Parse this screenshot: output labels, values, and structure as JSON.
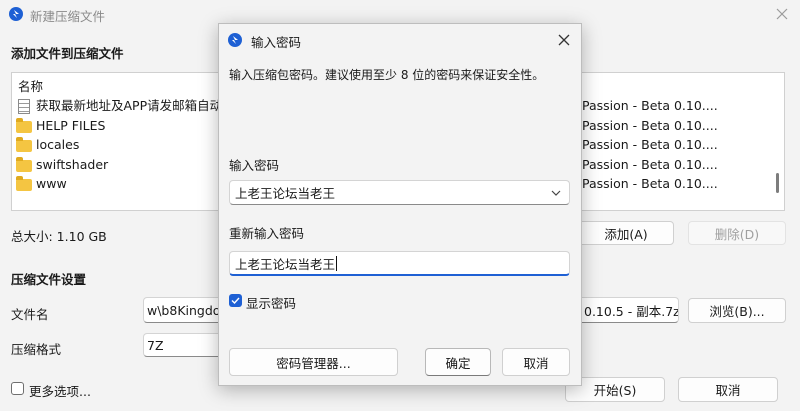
{
  "main": {
    "title": "新建压缩文件",
    "add_section_title": "添加文件到压缩文件",
    "list_header": "名称",
    "files": [
      {
        "icon": "document-icon",
        "name": "获取最新地址及APP请发邮箱自动"
      },
      {
        "icon": "folder-icon",
        "name": "HELP FILES"
      },
      {
        "icon": "folder-icon",
        "name": "locales"
      },
      {
        "icon": "folder-icon",
        "name": "swiftshader"
      },
      {
        "icon": "folder-icon",
        "name": "www"
      }
    ],
    "right_column": [
      "Passion - Beta 0.10....",
      "Passion - Beta 0.10....",
      "Passion - Beta 0.10....",
      "Passion - Beta 0.10....",
      "Passion - Beta 0.10...."
    ],
    "total_size": "总大小: 1.10 GB",
    "add_button": "添加(A)",
    "delete_button": "删除(D)",
    "settings_title": "压缩文件设置",
    "filename_label": "文件名",
    "filename_value_left": "w\\b8Kingdo",
    "filename_value_right": "0.10.5 - 副本.7z",
    "browse_button": "浏览(B)...",
    "format_label": "压缩格式",
    "format_value": "7Z",
    "more_options": "更多选项...",
    "start_button": "开始(S)",
    "cancel_button": "取消"
  },
  "dialog": {
    "title": "输入密码",
    "description": "输入压缩包密码。建议使用至少 8 位的密码来保证安全性。",
    "password_label": "输入密码",
    "password_value": "上老王论坛当老王",
    "reenter_label": "重新输入密码",
    "reenter_value": "上老王论坛当老王",
    "show_password": "显示密码",
    "manager_button": "密码管理器...",
    "ok_button": "确定",
    "cancel_button": "取消"
  },
  "colors": {
    "accent": "#1e60d4",
    "window_bg": "#f3f3f3"
  }
}
